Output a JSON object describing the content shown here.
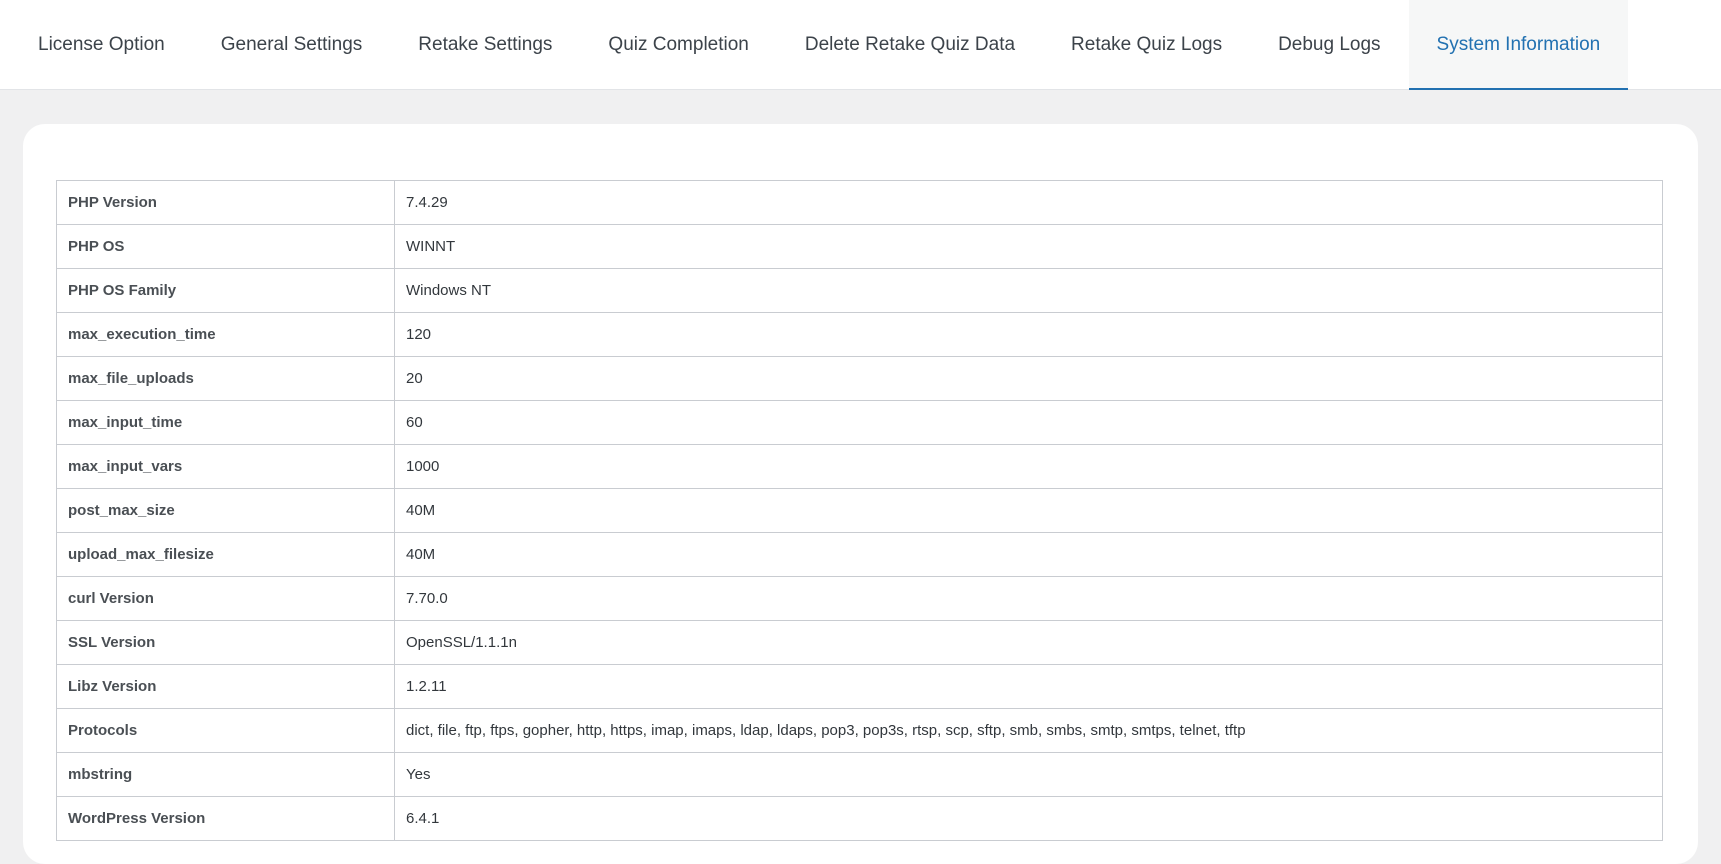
{
  "tabs": [
    {
      "label": "License Option",
      "active": false
    },
    {
      "label": "General Settings",
      "active": false
    },
    {
      "label": "Retake Settings",
      "active": false
    },
    {
      "label": "Quiz Completion",
      "active": false
    },
    {
      "label": "Delete Retake Quiz Data",
      "active": false
    },
    {
      "label": "Retake Quiz Logs",
      "active": false
    },
    {
      "label": "Debug Logs",
      "active": false
    },
    {
      "label": "System Information",
      "active": true
    }
  ],
  "system_info": [
    {
      "key": "PHP Version",
      "value": "7.4.29"
    },
    {
      "key": "PHP OS",
      "value": "WINNT"
    },
    {
      "key": "PHP OS Family",
      "value": "Windows NT"
    },
    {
      "key": "max_execution_time",
      "value": "120"
    },
    {
      "key": "max_file_uploads",
      "value": "20"
    },
    {
      "key": "max_input_time",
      "value": "60"
    },
    {
      "key": "max_input_vars",
      "value": "1000"
    },
    {
      "key": "post_max_size",
      "value": "40M"
    },
    {
      "key": "upload_max_filesize",
      "value": "40M"
    },
    {
      "key": "curl Version",
      "value": "7.70.0"
    },
    {
      "key": "SSL Version",
      "value": "OpenSSL/1.1.1n"
    },
    {
      "key": "Libz Version",
      "value": "1.2.11"
    },
    {
      "key": "Protocols",
      "value": "dict, file, ftp, ftps, gopher, http, https, imap, imaps, ldap, ldaps, pop3, pop3s, rtsp, scp, sftp, smb, smbs, smtp, smtps, telnet, tftp"
    },
    {
      "key": "mbstring",
      "value": "Yes"
    },
    {
      "key": "WordPress Version",
      "value": "6.4.1"
    }
  ],
  "colors": {
    "accent": "#2271b1",
    "page_background": "#f0f0f1",
    "card_background": "#ffffff",
    "border": "#c9ccd1"
  }
}
